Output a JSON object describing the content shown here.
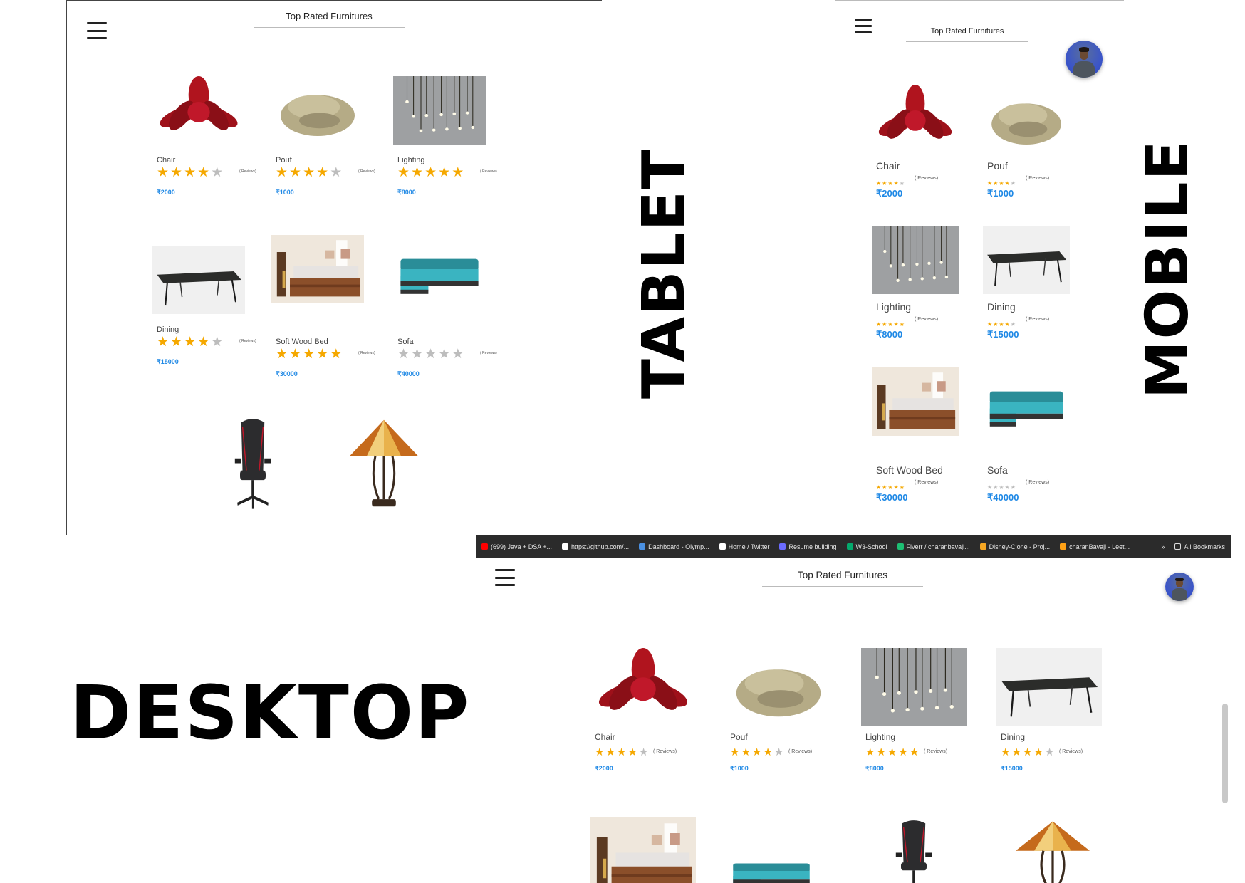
{
  "title": "Top Rated Furnitures",
  "labels": {
    "tablet": "TABLET",
    "mobile": "MOBILE",
    "desktop": "DESKTOP"
  },
  "products": [
    {
      "name": "Chair",
      "rating": 4,
      "reviews": "( Reviews)",
      "price": "₹2000",
      "icon": "flower-chair"
    },
    {
      "name": "Pouf",
      "rating": 4,
      "reviews": "( Reviews)",
      "price": "₹1000",
      "icon": "pouf"
    },
    {
      "name": "Lighting",
      "rating": 5,
      "reviews": "( Reviews)",
      "price": "₹8000",
      "icon": "pendant-lights"
    },
    {
      "name": "Dining",
      "rating": 4,
      "reviews": "( Reviews)",
      "price": "₹15000",
      "icon": "dining-table"
    },
    {
      "name": "Soft Wood Bed",
      "rating": 5,
      "reviews": "( Reviews)",
      "price": "₹30000",
      "icon": "bed"
    },
    {
      "name": "Sofa",
      "rating": 0,
      "reviews": "( Reviews)",
      "price": "₹40000",
      "icon": "sofa"
    }
  ],
  "extra_items": [
    {
      "icon": "gaming-chair"
    },
    {
      "icon": "tiffany-lamp"
    }
  ],
  "bookmarks": [
    {
      "label": "(699) Java + DSA +...",
      "color": "#ff0000"
    },
    {
      "label": "https://github.com/...",
      "color": "#ffffff"
    },
    {
      "label": "Dashboard - Olymp...",
      "color": "#4a90e2"
    },
    {
      "label": "Home / Twitter",
      "color": "#ffffff"
    },
    {
      "label": "Resume building",
      "color": "#6b6bff"
    },
    {
      "label": "W3-School",
      "color": "#04aa6d"
    },
    {
      "label": "Fiverr / charanbavaji...",
      "color": "#1dbf73"
    },
    {
      "label": "Disney-Clone - Proj...",
      "color": "#f5a623"
    },
    {
      "label": "charanBavaji - Leet...",
      "color": "#ffa116"
    }
  ],
  "bookmarks_more": "»",
  "all_bookmarks": "All Bookmarks",
  "colors": {
    "star_on": "#f5a800",
    "star_off": "#bdbdbd",
    "price": "#1e88e5",
    "bookmark_bar": "#2b2b2b"
  }
}
